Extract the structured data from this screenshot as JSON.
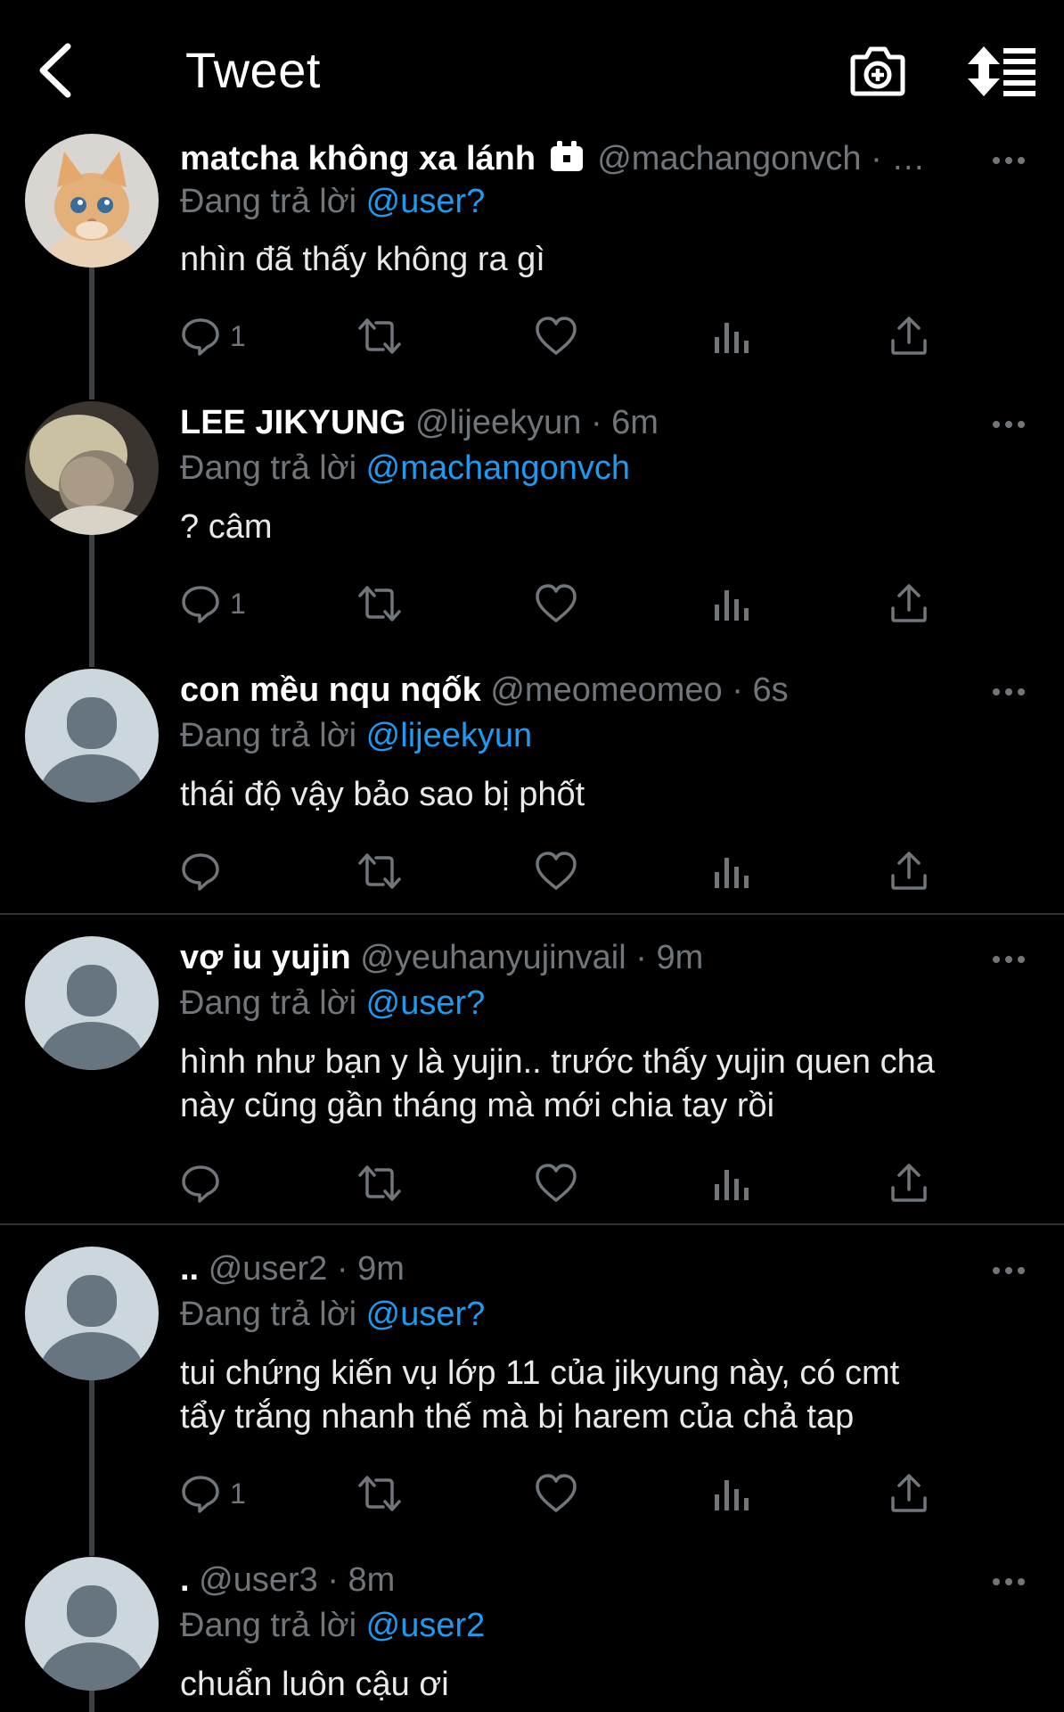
{
  "header": {
    "title": "Tweet",
    "back_icon": "chevron-left-icon",
    "camera_icon": "camera-plus-icon",
    "sort_icon": "sort-lines-icon"
  },
  "colors": {
    "link": "#1d9bf0",
    "muted": "#71767b",
    "background": "#000000"
  },
  "tweets": [
    {
      "name": "matcha không xa lánh",
      "badge_icon": "calendar-icon",
      "handle": "@machangonvch",
      "time": "· …",
      "reply_prefix": "Đang trả lời",
      "reply_to": "@user?",
      "lines": [
        "nhìn đã thấy không ra gì"
      ],
      "reply_count": "1"
    },
    {
      "name": "LEE JIKYUNG",
      "handle": "@lijeekyun",
      "time": "· 6m",
      "reply_prefix": "Đang trả lời",
      "reply_to": "@machangonvch",
      "lines": [
        "? câm"
      ],
      "reply_count": "1"
    },
    {
      "name": "con mều nqu nqốk",
      "handle": "@meomeomeo",
      "time": "· 6s",
      "reply_prefix": "Đang trả lời",
      "reply_to": "@lijeekyun",
      "lines": [
        "thái độ vậy bảo sao bị phốt"
      ],
      "reply_count": ""
    },
    {
      "name": "vợ iu yujin",
      "handle": "@yeuhanyujinvail",
      "time": "· 9m",
      "reply_prefix": "Đang trả lời",
      "reply_to": "@user?",
      "lines": [
        "hình như bạn y là yujin.. trước thấy yujin quen cha",
        "này cũng gần tháng mà mới chia tay rồi"
      ],
      "reply_count": ""
    },
    {
      "name": "..",
      "handle": "@user2",
      "time": "· 9m",
      "reply_prefix": "Đang trả lời",
      "reply_to": "@user?",
      "lines": [
        "tui chứng kiến vụ lớp 11 của jikyung này, có cmt",
        "tẩy trắng nhanh thế mà bị harem của chả tap"
      ],
      "reply_count": "1"
    },
    {
      "name": ".",
      "handle": "@user3",
      "time": "· 8m",
      "reply_prefix": "Đang trả lời",
      "reply_to": "@user2",
      "lines": [
        "chuẩn luôn cậu ơi"
      ],
      "reply_count": ""
    }
  ]
}
